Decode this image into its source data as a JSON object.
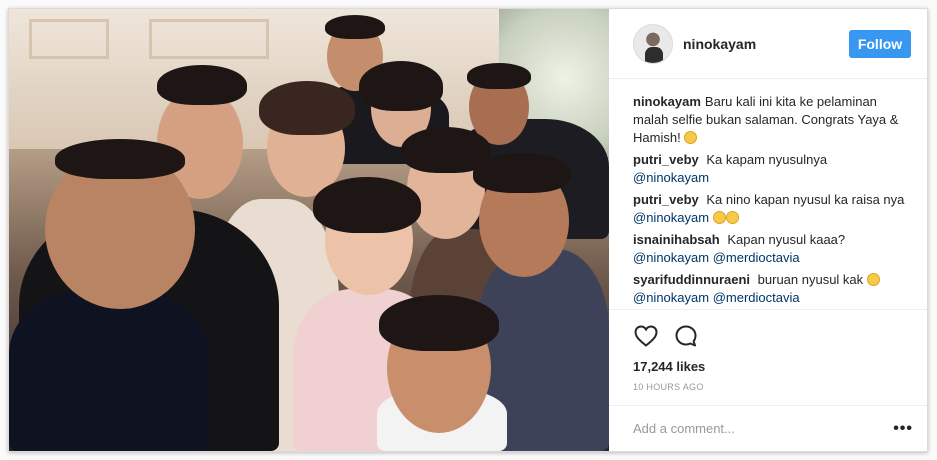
{
  "post": {
    "username": "ninokayam",
    "follow_label": "Follow",
    "caption": {
      "user": "ninokayam",
      "text": "Baru kali ini kita ke pelaminan malah selfie bukan salaman. Congrats Yaya & Hamish! ",
      "emoji": "smiling-face"
    },
    "comments": [
      {
        "user": "putri_veby",
        "text": "Ka kapam nyusulnya",
        "mentions": [
          "@ninokayam"
        ]
      },
      {
        "user": "putri_veby",
        "text": "Ka nino kapan nyusul ka raisa nya",
        "mentions": [
          "@ninokayam"
        ],
        "emojis": 2
      },
      {
        "user": "isnainihabsah",
        "text": "Kapan nyusul kaaa?",
        "mentions": [
          "@ninokayam",
          "@merdioctavia"
        ]
      },
      {
        "user": "syarifuddinnuraeni",
        "text": "buruan nyusul kak",
        "mentions": [
          "@ninokayam",
          "@merdioctavia"
        ],
        "emojis": 1
      }
    ],
    "likes": "17,244 likes",
    "time": "10 HOURS AGO",
    "add_comment_placeholder": "Add a comment...",
    "more_label": "•••",
    "icons": {
      "like": "heart-icon",
      "comment": "comment-bubble-icon"
    },
    "colors": {
      "follow_button": "#3897f0",
      "mention": "#003569",
      "muted": "#999999"
    }
  }
}
